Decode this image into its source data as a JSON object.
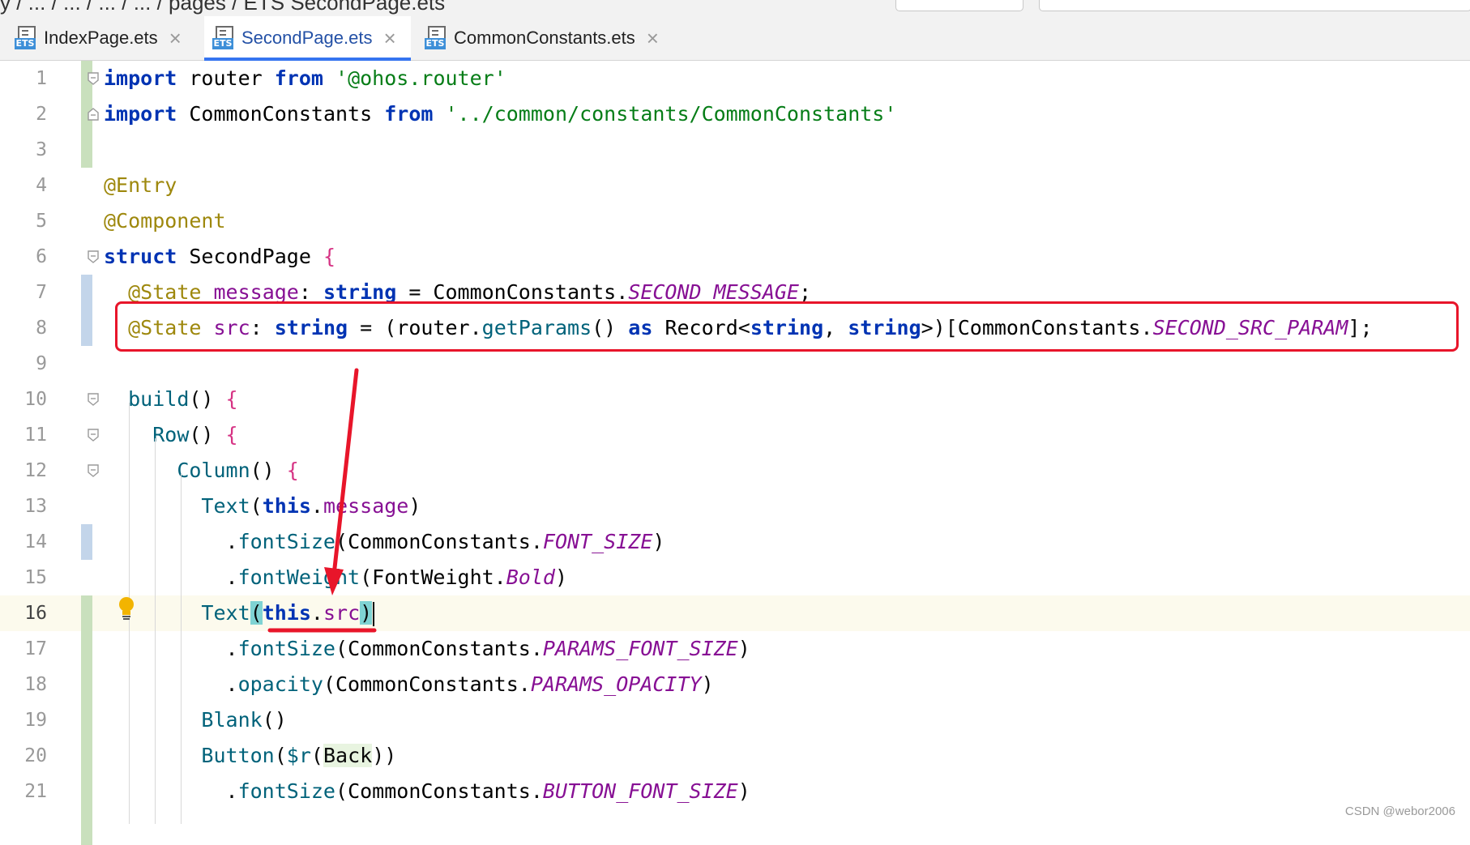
{
  "top_bar": {
    "breadcrumb": "y / ... / ... / ... / ... / pages / ETS SecondPage.ets"
  },
  "tabs": [
    {
      "label": "IndexPage.ets",
      "icon": "ets-file-icon",
      "active": false
    },
    {
      "label": "SecondPage.ets",
      "icon": "ets-file-icon",
      "active": true
    },
    {
      "label": "CommonConstants.ets",
      "icon": "ets-file-icon",
      "active": false
    }
  ],
  "editor": {
    "current_line": 16,
    "line_numbers": [
      "1",
      "2",
      "3",
      "4",
      "5",
      "6",
      "7",
      "8",
      "9",
      "10",
      "11",
      "12",
      "13",
      "14",
      "15",
      "16",
      "17",
      "18",
      "19",
      "20",
      "21"
    ],
    "lines": [
      "import router from '@ohos.router'",
      "import CommonConstants from '../common/constants/CommonConstants'",
      "",
      "@Entry",
      "@Component",
      "struct SecondPage {",
      "  @State message: string = CommonConstants.SECOND_MESSAGE;",
      "  @State src: string = (router.getParams() as Record<string, string>)[CommonConstants.SECOND_SRC_PARAM];",
      "",
      "  build() {",
      "    Row() {",
      "      Column() {",
      "        Text(this.message)",
      "          .fontSize(CommonConstants.FONT_SIZE)",
      "          .fontWeight(FontWeight.Bold)",
      "        Text(this.src)",
      "          .fontSize(CommonConstants.PARAMS_FONT_SIZE)",
      "          .opacity(CommonConstants.PARAMS_OPACITY)",
      "        Blank()",
      "        Button($r(Back))",
      "          .fontSize(CommonConstants.BUTTON_FONT_SIZE)"
    ]
  },
  "annotations": {
    "highlight_color": "#e8152a",
    "highlight_box_target_line": 8,
    "arrow_target": "this.src"
  },
  "colors": {
    "keyword": "#0033b3",
    "annotation": "#9e880d",
    "string": "#067d17",
    "function": "#00627a",
    "constant": "#871094",
    "active_tab": "#3574f0",
    "gutter_added": "#c9e0bd",
    "gutter_modified": "#c3d5ea"
  },
  "watermark": "CSDN @webor2006"
}
